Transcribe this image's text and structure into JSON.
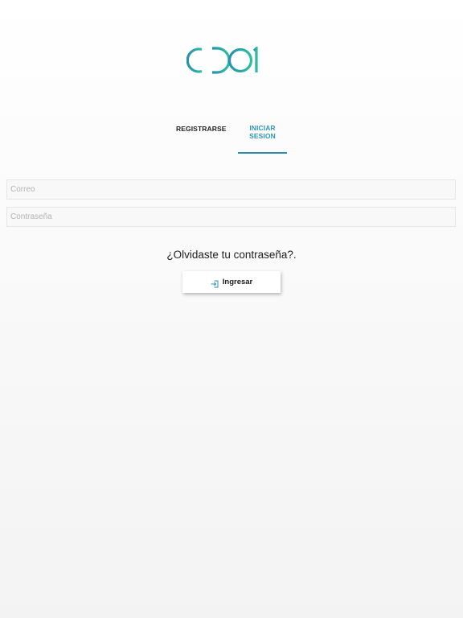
{
  "logo": {
    "text": "CIDOI",
    "colors": [
      "#2a8fb0",
      "#2bbf9f"
    ]
  },
  "tabs": [
    {
      "label": "REGISTRARSE",
      "active": false
    },
    {
      "label": "INICIAR SESION",
      "active": true
    }
  ],
  "colors": {
    "accent": "#2a8fb0",
    "tab_active_text": "#2f96b4"
  },
  "form": {
    "email_placeholder": "Correo",
    "email_value": "",
    "password_placeholder": "Contraseña",
    "password_value": ""
  },
  "forgot_password": "¿Olvidaste tu contraseña?.",
  "login_button": {
    "label": "Ingresar",
    "icon": "sign-in-icon"
  }
}
